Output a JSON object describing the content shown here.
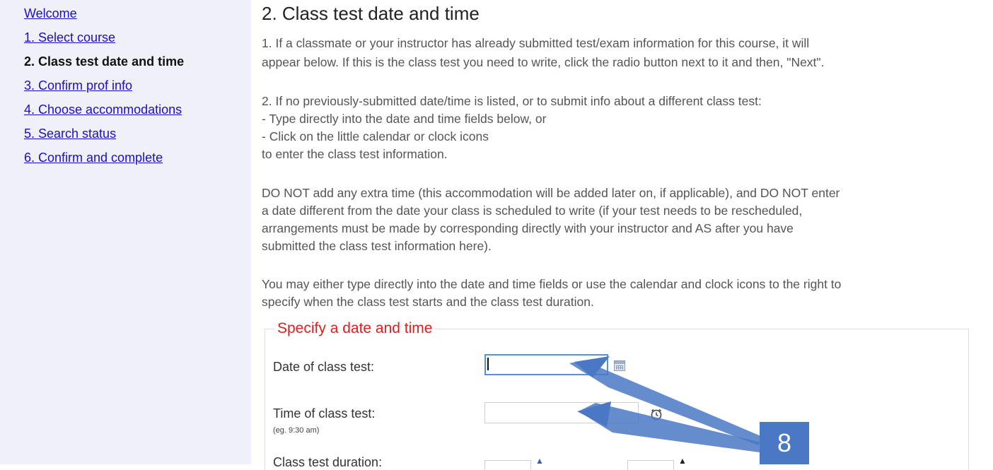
{
  "sidebar": {
    "items": [
      {
        "label": "Welcome",
        "current": false
      },
      {
        "label": "1. Select course",
        "current": false
      },
      {
        "label": "2. Class test date and time",
        "current": true
      },
      {
        "label": "3. Confirm prof info",
        "current": false
      },
      {
        "label": "4. Choose accommodations",
        "current": false
      },
      {
        "label": "5. Search status",
        "current": false
      },
      {
        "label": "6. Confirm and complete",
        "current": false
      }
    ]
  },
  "main": {
    "title": "2. Class test date and time",
    "intro": {
      "line1": "1. If a classmate or your instructor has already submitted test/exam information for this course, it will",
      "line2": "appear below. If this is the class test you need to write, click the radio button next to it and then, \"Next\"."
    },
    "instructions": {
      "line1": "2. If no previously-submitted date/time is listed, or to submit info about a different class test:",
      "line2": "- Type directly into the date and time fields below, or",
      "line3": "- Click on the little calendar or clock icons",
      "line4": "to enter the class test information."
    },
    "warning": {
      "line1": "DO NOT add any extra time (this accommodation will be added later on, if applicable), and DO NOT enter",
      "line2": "a date different from the date your class is scheduled to write (if your test needs to be rescheduled,",
      "line3": "arrangements must be made by corresponding directly with your instructor and AS after you have",
      "line4": "submitted the class test information here)."
    },
    "hint_para": {
      "line1": "You may either type directly into the date and time fields or use the calendar and clock icons to the right to",
      "line2": "specify when the class test starts and the class test duration."
    }
  },
  "form": {
    "legend": "Specify a date and time",
    "date_label": "Date of class test:",
    "date_value": "",
    "time_label": "Time of class test:",
    "time_hint": "(eg. 9:30 am)",
    "time_value": "",
    "duration_label": "Class test duration:"
  },
  "annotation": {
    "step_number": "8",
    "color": "#4a78c4"
  },
  "icons": {
    "date_picker": "calendar-icon",
    "time_picker": "clock-icon"
  }
}
